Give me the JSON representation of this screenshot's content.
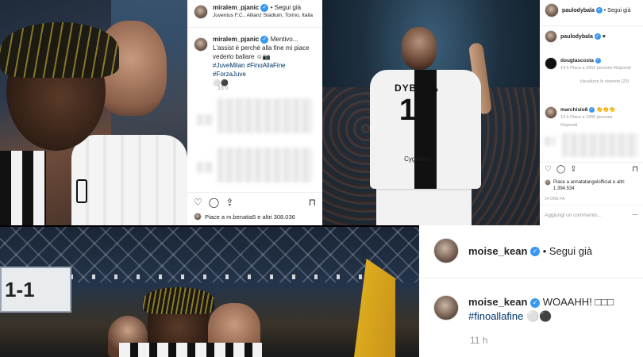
{
  "post_pjanic": {
    "username": "miralem_pjanic",
    "follow": "Segui già",
    "location": "Juventus F.C., Allianz Stadium, Torino, Italia",
    "caption_user": "miralem_pjanic",
    "caption_line1": "Mentivo...",
    "caption_line2": "L'assist è perché alla fine mi piace",
    "caption_line3": "vederlo ballare",
    "hashtags": "#JuveMilan #FinoAllaFine #ForzaJuve",
    "time": "15 h",
    "likes": "Piace a m.benatia5 e altri 308.036"
  },
  "post_dybala": {
    "username": "paulodybala",
    "follow": "Segui già",
    "caption_user": "paulodybala",
    "caption_text": "♥",
    "c1_user": "douglascosta",
    "c1_meta": "14 h   Piace a 2952 persone   Rispondi",
    "c1_replies": "Visualizza le risposte (23)",
    "c2_user": "marchisio8",
    "c2_text": "👏👏👏",
    "c2_meta": "13 h   Piace a 1960 persone",
    "c2_reply": "Rispondi",
    "likes": "Piace a annatatangelofficial e altri 1.394.534",
    "date": "14 ORE FA",
    "comment_placeholder": "Aggiungi un commento..."
  },
  "post_kean": {
    "username": "moise_kean",
    "follow": "Segui già",
    "caption_user": "moise_kean",
    "caption_text": "WOAAHH! ",
    "hashtag": "#finoallafine",
    "time": "11 h"
  },
  "photos": {
    "dybala_name": "DYBALA",
    "dybala_number": "10",
    "sponsor": "Cygames",
    "score": "1-1"
  }
}
